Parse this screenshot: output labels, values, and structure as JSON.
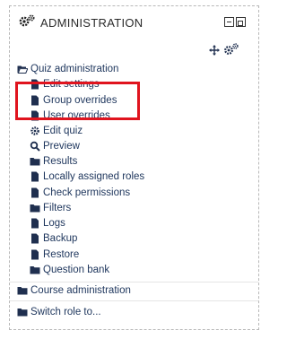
{
  "block": {
    "title": "ADMINISTRATION",
    "header_icon": "gears-icon",
    "move_icon": "move-arrows-icon",
    "actions_icon": "gears-menu-icon",
    "minimize_icon": "minimize-box-icon",
    "dock_icon": "dock-box-icon"
  },
  "tree": {
    "quiz_admin": {
      "label": "Quiz administration",
      "icon": "folder-open-icon"
    },
    "items": [
      {
        "label": "Edit settings",
        "icon": "file-icon"
      },
      {
        "label": "Group overrides",
        "icon": "file-icon"
      },
      {
        "label": "User overrides",
        "icon": "file-icon"
      },
      {
        "label": "Edit quiz",
        "icon": "gear-icon"
      },
      {
        "label": "Preview",
        "icon": "magnifier-icon"
      },
      {
        "label": "Results",
        "icon": "folder-icon"
      },
      {
        "label": "Locally assigned roles",
        "icon": "file-icon"
      },
      {
        "label": "Check permissions",
        "icon": "file-icon"
      },
      {
        "label": "Filters",
        "icon": "folder-icon"
      },
      {
        "label": "Logs",
        "icon": "file-icon"
      },
      {
        "label": "Backup",
        "icon": "file-icon"
      },
      {
        "label": "Restore",
        "icon": "file-icon"
      },
      {
        "label": "Question bank",
        "icon": "folder-icon"
      }
    ],
    "course_admin": {
      "label": "Course administration",
      "icon": "folder-icon"
    },
    "switch_role": {
      "label": "Switch role to...",
      "icon": "folder-icon"
    }
  },
  "colors": {
    "highlight": "#e0141e",
    "text": "#1d355c",
    "icon": "#1f2f4f"
  }
}
